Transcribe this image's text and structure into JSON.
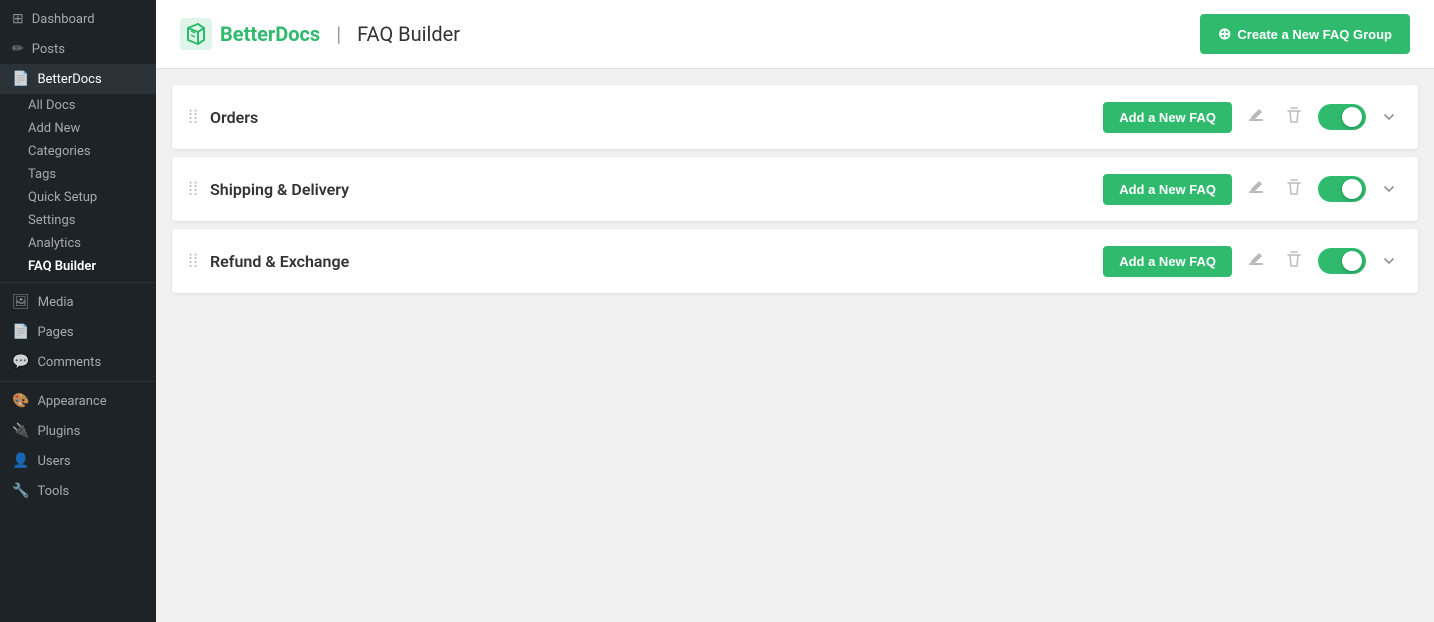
{
  "sidebar": {
    "items": [
      {
        "id": "dashboard",
        "label": "Dashboard",
        "icon": "⊞",
        "active": false
      },
      {
        "id": "posts",
        "label": "Posts",
        "icon": "📝",
        "active": false
      },
      {
        "id": "betterdocs",
        "label": "BetterDocs",
        "icon": "📄",
        "active": true
      },
      {
        "id": "media",
        "label": "Media",
        "icon": "🖼",
        "active": false
      },
      {
        "id": "pages",
        "label": "Pages",
        "icon": "📄",
        "active": false
      },
      {
        "id": "comments",
        "label": "Comments",
        "icon": "💬",
        "active": false
      },
      {
        "id": "appearance",
        "label": "Appearance",
        "icon": "🎨",
        "active": false
      },
      {
        "id": "plugins",
        "label": "Plugins",
        "icon": "🔌",
        "active": false
      },
      {
        "id": "users",
        "label": "Users",
        "icon": "👤",
        "active": false
      },
      {
        "id": "tools",
        "label": "Tools",
        "icon": "🔧",
        "active": false
      }
    ],
    "betterdocs_sub": [
      {
        "id": "all-docs",
        "label": "All Docs",
        "active": false
      },
      {
        "id": "add-new",
        "label": "Add New",
        "active": false
      },
      {
        "id": "categories",
        "label": "Categories",
        "active": false
      },
      {
        "id": "tags",
        "label": "Tags",
        "active": false
      },
      {
        "id": "quick-setup",
        "label": "Quick Setup",
        "active": false
      },
      {
        "id": "settings",
        "label": "Settings",
        "active": false
      },
      {
        "id": "analytics",
        "label": "Analytics",
        "active": false
      },
      {
        "id": "faq-builder",
        "label": "FAQ Builder",
        "active": true
      }
    ]
  },
  "header": {
    "brand_name": "BetterDocs",
    "separator": "|",
    "page_title": "FAQ Builder",
    "create_button_label": "Create a New FAQ Group",
    "create_button_icon": "+"
  },
  "faq_groups": [
    {
      "id": "orders",
      "name": "Orders",
      "add_faq_label": "Add a New FAQ",
      "enabled": true
    },
    {
      "id": "shipping",
      "name": "Shipping & Delivery",
      "add_faq_label": "Add a New FAQ",
      "enabled": true
    },
    {
      "id": "refund",
      "name": "Refund & Exchange",
      "add_faq_label": "Add a New FAQ",
      "enabled": true
    }
  ],
  "colors": {
    "green": "#2fba6e",
    "sidebar_bg": "#1d2327",
    "sidebar_active": "#2c3338"
  }
}
